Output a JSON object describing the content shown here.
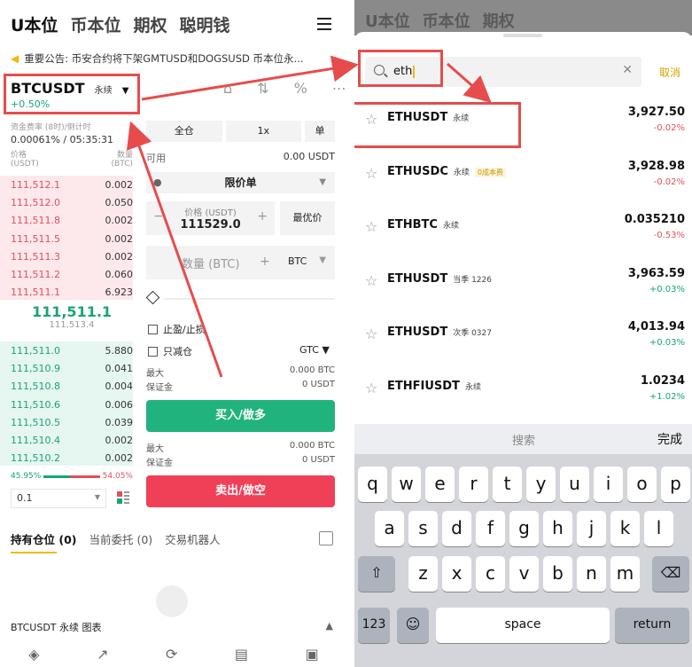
{
  "left": {
    "nav": [
      "U本位",
      "币本位",
      "期权",
      "聪明钱"
    ],
    "notice": "重要公告: 币安合约将下架GMTUSD和DOGSUSD 币本位永...",
    "symbol": {
      "name": "BTCUSDT",
      "type": "永续",
      "change": "+0.50%"
    },
    "funding": {
      "label": "资金费率 (8时)/倒计时",
      "value": "0.00061% / 05:35:31"
    },
    "orderbook": {
      "price_header": "价格\n(USDT)",
      "qty_header": "数量\n(BTC)",
      "asks": [
        {
          "p": "111,512.1",
          "q": "0.002"
        },
        {
          "p": "111,512.0",
          "q": "0.050"
        },
        {
          "p": "111,511.8",
          "q": "0.002"
        },
        {
          "p": "111,511.5",
          "q": "0.002"
        },
        {
          "p": "111,511.3",
          "q": "0.002"
        },
        {
          "p": "111,511.2",
          "q": "0.060"
        },
        {
          "p": "111,511.1",
          "q": "6.923"
        }
      ],
      "mid_price": "111,511.1",
      "mark_price": "111,513.4",
      "bids": [
        {
          "p": "111,511.0",
          "q": "5.880"
        },
        {
          "p": "111,510.9",
          "q": "0.041"
        },
        {
          "p": "111,510.8",
          "q": "0.004"
        },
        {
          "p": "111,510.6",
          "q": "0.006"
        },
        {
          "p": "111,510.5",
          "q": "0.039"
        },
        {
          "p": "111,510.4",
          "q": "0.002"
        },
        {
          "p": "111,510.2",
          "q": "0.002"
        }
      ],
      "buy_ratio": "45.95%",
      "sell_ratio": "54.05%",
      "depth": "0.1"
    },
    "form": {
      "margin_mode": "全仓",
      "leverage": "1x",
      "side_mode": "单",
      "avail_label": "可用",
      "avail_value": "0.00 USDT",
      "order_type": "限价单",
      "price_label": "价格 (USDT)",
      "price_value": "111529.0",
      "best_price": "最优价",
      "qty_placeholder": "数量 (BTC)",
      "qty_unit": "BTC",
      "tpsl": "止盈/止损",
      "reduce_only": "只减仓",
      "tif": "GTC",
      "max_label": "最大",
      "max_value": "0.000 BTC",
      "margin_label": "保证金",
      "margin_value": "0 USDT",
      "buy": "买入/做多",
      "sell": "卖出/做空"
    },
    "tabs": [
      "持有仓位 (0)",
      "当前委托 (0)",
      "交易机器人"
    ],
    "bottom_symbol": "BTCUSDT 永续  图表"
  },
  "right": {
    "dim_nav": [
      "U本位",
      "币本位",
      "期权"
    ],
    "search_value": "eth",
    "cancel": "取消",
    "results": [
      {
        "name": "ETHUSDT",
        "type": "永续",
        "badge": "",
        "price": "3,927.50",
        "change": "-0.02%",
        "dir": "dn"
      },
      {
        "name": "ETHUSDC",
        "type": "永续",
        "badge": "0成本费",
        "price": "3,928.98",
        "change": "-0.02%",
        "dir": "dn"
      },
      {
        "name": "ETHBTC",
        "type": "永续",
        "badge": "",
        "price": "0.035210",
        "change": "-0.53%",
        "dir": "dn"
      },
      {
        "name": "ETHUSDT",
        "type": "当季 1226",
        "badge": "",
        "price": "3,963.59",
        "change": "+0.03%",
        "dir": "up"
      },
      {
        "name": "ETHUSDT",
        "type": "次季 0327",
        "badge": "",
        "price": "4,013.94",
        "change": "+0.03%",
        "dir": "up"
      },
      {
        "name": "ETHFIUSDT",
        "type": "永续",
        "badge": "",
        "price": "1.0234",
        "change": "+1.02%",
        "dir": "up"
      }
    ],
    "keyboard": {
      "search_label": "搜索",
      "done_label": "完成",
      "row1": [
        "q",
        "w",
        "e",
        "r",
        "t",
        "y",
        "u",
        "i",
        "o",
        "p"
      ],
      "row2": [
        "a",
        "s",
        "d",
        "f",
        "g",
        "h",
        "j",
        "k",
        "l"
      ],
      "row3": [
        "z",
        "x",
        "c",
        "v",
        "b",
        "n",
        "m"
      ],
      "numbers_key": "123",
      "space_key": "space",
      "return_key": "return"
    }
  },
  "colors": {
    "green": "#1aa37a",
    "red": "#e0505a",
    "brand": "#f0b90b",
    "annotation": "#e74c4c"
  }
}
